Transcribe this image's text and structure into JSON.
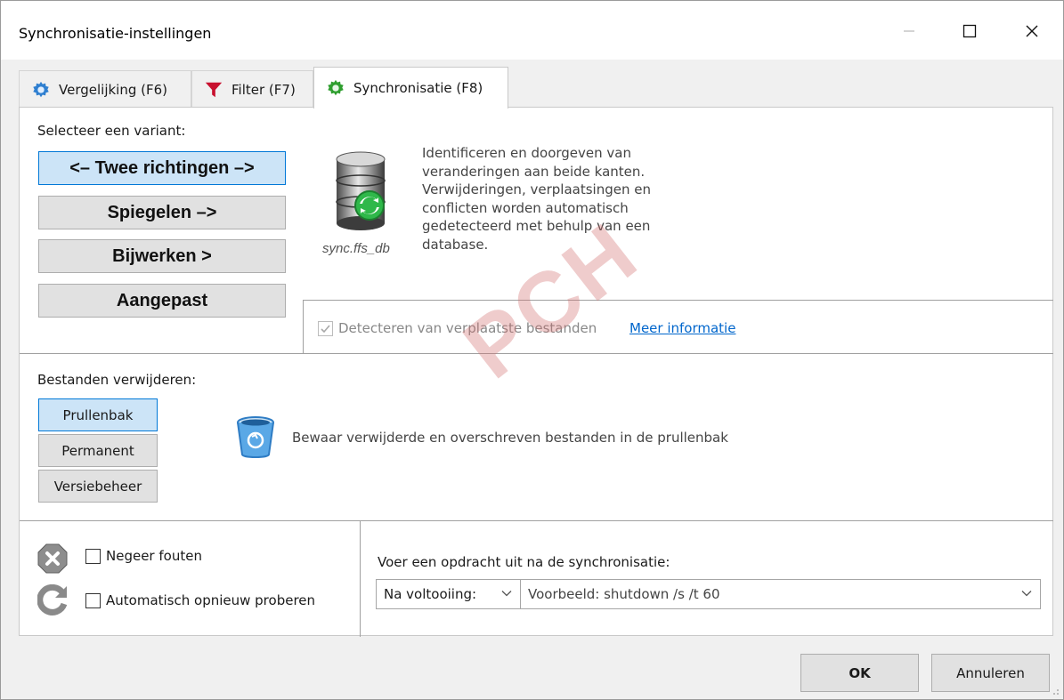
{
  "window": {
    "title": "Synchronisatie-instellingen"
  },
  "tabs": [
    {
      "label": "Vergelijking (F6)",
      "icon": "gear-icon",
      "color": "#2f7fd0"
    },
    {
      "label": "Filter (F7)",
      "icon": "funnel-icon",
      "color": "#c8102e"
    },
    {
      "label": "Synchronisatie (F8)",
      "icon": "gear-icon",
      "color": "#2e9e2e",
      "active": true
    }
  ],
  "variant": {
    "heading": "Selecteer een variant:",
    "options": [
      {
        "label": "<– Twee richtingen –>",
        "selected": true
      },
      {
        "label": "Spiegelen –>",
        "selected": false
      },
      {
        "label": "Bijwerken >",
        "selected": false
      },
      {
        "label": "Aangepast",
        "selected": false
      }
    ],
    "db_icon": "database-sync-icon",
    "db_caption": "sync.ffs_db",
    "description": "Identificeren en doorgeven van veranderingen aan beide kanten. Verwijderingen, verplaatsingen en conflicten worden automatisch gedetecteerd met behulp van een database.",
    "detect_moved_label": "Detecteren van verplaatste bestanden",
    "detect_moved_checked": true,
    "detect_moved_enabled": false,
    "more_info_link": "Meer informatie"
  },
  "deletion": {
    "heading": "Bestanden verwijderen:",
    "options": [
      {
        "label": "Prullenbak",
        "selected": true
      },
      {
        "label": "Permanent",
        "selected": false
      },
      {
        "label": "Versiebeheer",
        "selected": false
      }
    ],
    "icon": "recycle-bin-icon",
    "description": "Bewaar verwijderde en overschreven bestanden in de prullenbak"
  },
  "errors": {
    "ignore_errors_label": "Negeer fouten",
    "ignore_errors_checked": false,
    "auto_retry_label": "Automatisch opnieuw proberen",
    "auto_retry_checked": false
  },
  "post_sync": {
    "label": "Voer een opdracht uit na de synchronisatie:",
    "when_value": "Na voltooiing:",
    "command_placeholder": "Voorbeeld: shutdown /s /t 60"
  },
  "footer": {
    "ok_label": "OK",
    "cancel_label": "Annuleren"
  },
  "watermark": "PCH",
  "colors": {
    "selected_bg": "#cce4f7",
    "selected_border": "#0078d7",
    "link": "#0066cc"
  }
}
